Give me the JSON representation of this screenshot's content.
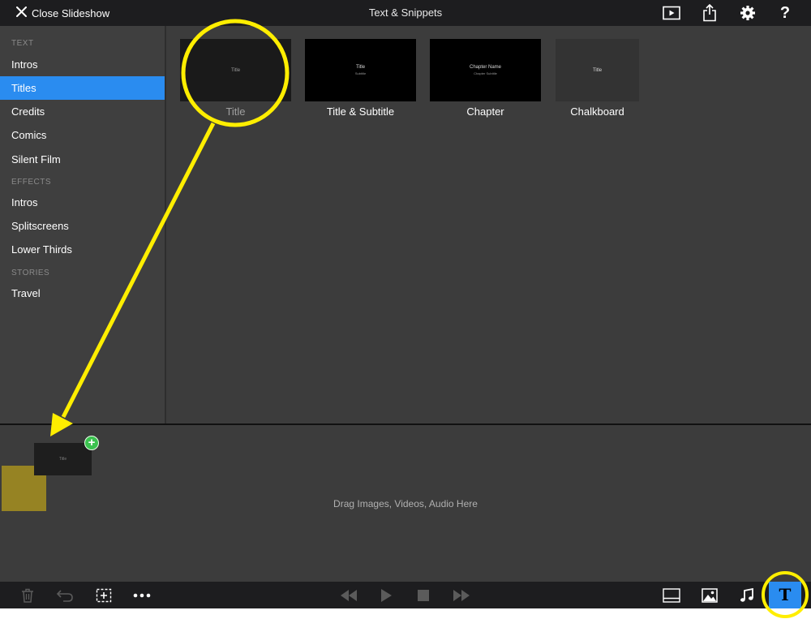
{
  "topbar": {
    "close_label": "Close Slideshow",
    "title": "Text & Snippets",
    "icons": [
      "play-preview-icon",
      "share-icon",
      "settings-gear-icon",
      "help-icon"
    ],
    "help_glyph": "?"
  },
  "sidebar": {
    "sections": [
      {
        "header": "TEXT",
        "items": [
          "Intros",
          "Titles",
          "Credits",
          "Comics",
          "Silent Film"
        ]
      },
      {
        "header": "EFFECTS",
        "items": [
          "Intros",
          "Splitscreens",
          "Lower Thirds"
        ]
      },
      {
        "header": "STORIES",
        "items": [
          "Travel"
        ]
      }
    ],
    "selected": "Titles"
  },
  "tiles": [
    {
      "label": "Title",
      "thumb_line1": "Title",
      "thumb_line2": ""
    },
    {
      "label": "Title & Subtitle",
      "thumb_line1": "Title",
      "thumb_line2": "Subtitle"
    },
    {
      "label": "Chapter",
      "thumb_line1": "Chapter Name",
      "thumb_line2": "Chapter Subtitle"
    },
    {
      "label": "Chalkboard",
      "thumb_line1": "Title",
      "thumb_line2": ""
    }
  ],
  "timeline": {
    "drop_hint": "Drag Images, Videos, Audio Here",
    "dragged_thumb_text": "Title",
    "add_badge": "+"
  },
  "bottombar": {
    "left_icons": [
      "trash-icon",
      "undo-icon",
      "add-clip-icon",
      "more-icon"
    ],
    "center_icons": [
      "rewind-icon",
      "play-icon",
      "stop-icon",
      "fast-forward-icon"
    ],
    "right_icons": [
      "layout-icon",
      "photo-icon",
      "music-icon",
      "text-tool-icon"
    ],
    "text_tool_glyph": "T"
  },
  "colors": {
    "accent": "#2a8cf0",
    "annotation": "#ffee00",
    "add_badge": "#3bc24f"
  }
}
